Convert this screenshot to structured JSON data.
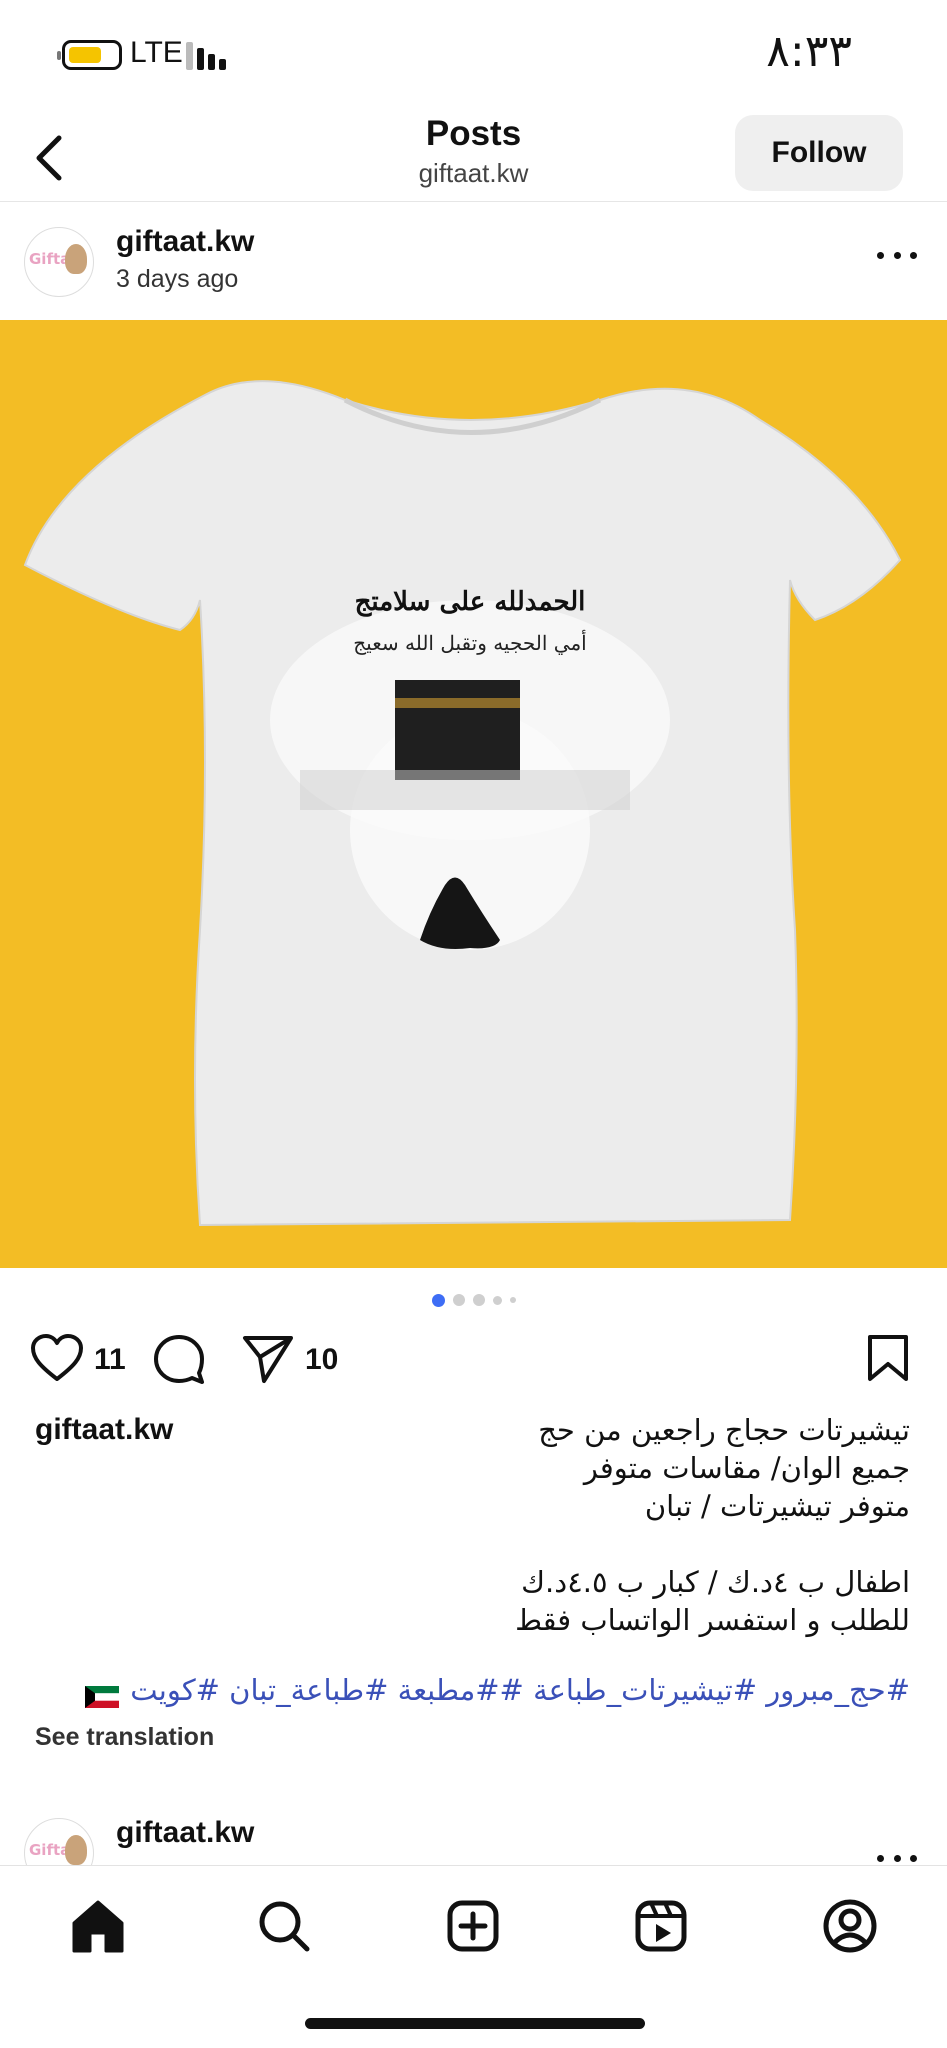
{
  "status_bar": {
    "network": "LTE",
    "time": "٨:٣٣"
  },
  "header": {
    "title": "Posts",
    "subtitle": "giftaat.kw",
    "follow_label": "Follow"
  },
  "post": {
    "username": "giftaat.kw",
    "time_ago": "3 days ago",
    "avatar_logo_text": "Gifta",
    "image": {
      "background_color": "#f3bd25",
      "print_line1": "الحمدلله على سلامتج",
      "print_line2": "أمي الحجيه وتقبل الله سعيج"
    },
    "carousel": {
      "total": 5,
      "active_index": 0,
      "active_color": "#3e6df5"
    },
    "likes": "11",
    "shares": "10",
    "caption_user": "giftaat.kw",
    "caption_lines": [
      "تيشيرتات حجاج راجعين من حج",
      "جميع الوان/ مقاسات متوفر",
      "متوفر تيشيرتات / تبان",
      "",
      "اطفال ب ٤د.ك / كبار ب ٤.٥د.ك",
      "للطلب و استفسر الواتساب فقط"
    ],
    "hashtags": "#حج_مبرور #تيشيرتات_طباعة ##مطبعة #طباعة_تبان #كويت",
    "see_translation": "See translation"
  },
  "next_post": {
    "username": "giftaat.kw"
  },
  "nav": {
    "items": [
      "home-icon",
      "search-icon",
      "create-icon",
      "reels-icon",
      "profile-icon"
    ]
  }
}
